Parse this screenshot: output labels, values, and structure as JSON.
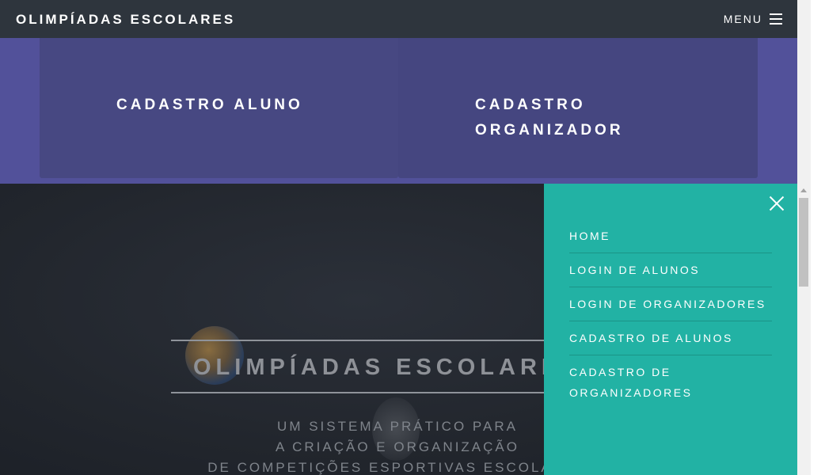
{
  "navbar": {
    "brand": "OLIMPÍADAS ESCOLARES",
    "menu_label": "MENU"
  },
  "cards": [
    {
      "title": "CADASTRO ALUNO"
    },
    {
      "title": "CADASTRO ORGANIZADOR"
    }
  ],
  "hero": {
    "title": "OLIMPÍADAS ESCOLARES",
    "subtitle_lines": [
      "UM SISTEMA PRÁTICO PARA",
      "A CRIAÇÃO E ORGANIZAÇÃO",
      "DE COMPETIÇÕES ESPORTIVAS ESCOLARES"
    ]
  },
  "sidemenu": {
    "items": [
      {
        "label": "HOME"
      },
      {
        "label": "LOGIN DE ALUNOS"
      },
      {
        "label": "LOGIN DE ORGANIZADORES"
      },
      {
        "label": "CADASTRO DE ALUNOS"
      },
      {
        "label": "CADASTRO DE ORGANIZADORES"
      }
    ]
  },
  "colors": {
    "navbar": "#2e353d",
    "purple_section": "#52519a",
    "sidemenu": "#22b2a4"
  },
  "icons": {
    "menu": "hamburger-icon",
    "close": "close-icon"
  }
}
